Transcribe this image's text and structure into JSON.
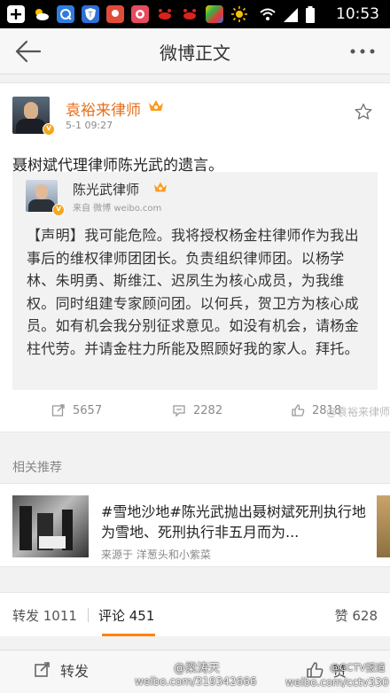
{
  "status_bar": {
    "time": "10:53",
    "left_icons": [
      "add-icon",
      "weather-icon",
      "browser-icon",
      "shield-icon",
      "location-icon",
      "camera-icon",
      "crab-icon",
      "crab-icon",
      "app-icon",
      "sun-icon"
    ],
    "right_icons": [
      "wifi-icon",
      "signal-icon",
      "battery-icon"
    ]
  },
  "nav": {
    "title": "微博正文"
  },
  "post": {
    "author": "袁裕来律师",
    "time": "5-1 09:27",
    "text": "聂树斌代理律师陈光武的遗言。",
    "quote": {
      "author": "陈光武律师",
      "source": "来自 微博 weibo.com",
      "body": "【声明】我可能危险。我将授权杨金柱律师作为我出事后的维权律师团团长。负责组织律师团。以杨学林、朱明勇、斯维江、迟夙生为核心成员，为我维权。同时组建专家顾问团。以何兵，贺卫方为核心成员。如有机会我分别征求意见。如没有机会，请杨金柱代劳。并请金柱力所能及照顾好我的家人。拜托。"
    },
    "actions": {
      "repost": "5657",
      "comment": "2282",
      "like": "2818"
    },
    "watermark": "@袁裕来律师"
  },
  "related": {
    "label": "相关推荐",
    "title": "#雪地沙地#陈光武抛出聂树斌死刑执行地为雪地、死刑执行非五月而为...",
    "source": "来源于 洋葱头和小紫菜"
  },
  "counts": {
    "repost": "转发 1011",
    "comment": "评论 451",
    "like": "赞 628"
  },
  "toolbar": {
    "repost": "转发",
    "like": "赞"
  },
  "watermarks": {
    "left_handle": "@梁涛天",
    "left_url": "weibo.com/319342666",
    "right_handle": "@CCTV报道",
    "right_url": "weibo.com/cctv330"
  },
  "colors": {
    "accent": "#e86f1b",
    "tab_active": "#ff8200",
    "verified": "#f5a623"
  }
}
